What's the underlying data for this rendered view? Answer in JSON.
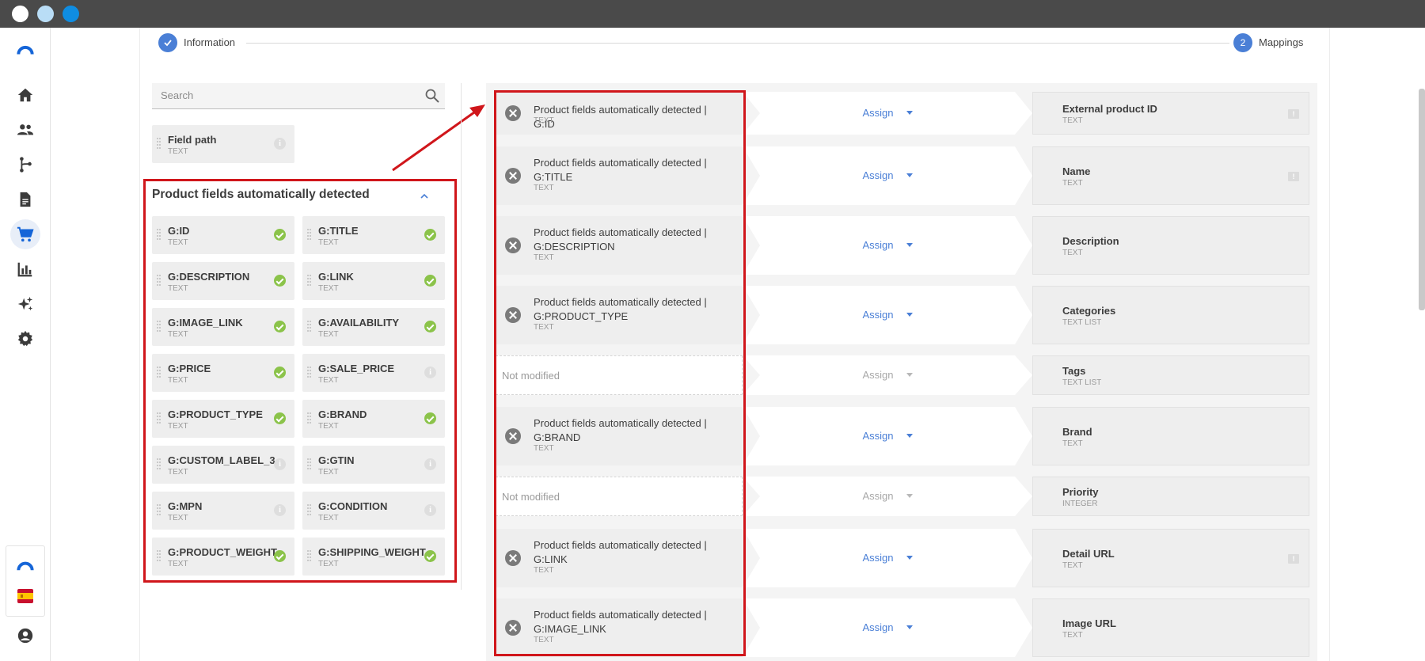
{
  "window": {
    "controls": [
      "close",
      "minimize",
      "maximize"
    ],
    "colors": {
      "close": "#ffffff",
      "minimize": "#b9ddf6",
      "maximize": "#0f8de2",
      "titlebar": "#4a4a4a"
    }
  },
  "nav": {
    "items": [
      "home-icon",
      "users-icon",
      "workflow-icon",
      "document-icon",
      "cart-icon",
      "chart-icon",
      "sparkles-icon",
      "gear-icon"
    ],
    "active": "cart-icon",
    "bottom": [
      "brand-logo-icon",
      "spain-flag-icon",
      "account-icon"
    ]
  },
  "stepper": {
    "steps": [
      {
        "label": "Information",
        "state": "done"
      },
      {
        "label": "Mappings",
        "number": "2",
        "state": "current"
      }
    ]
  },
  "search": {
    "placeholder": "Search"
  },
  "standalone_field": {
    "name": "Field path",
    "type": "TEXT",
    "status": "info"
  },
  "group": {
    "title": "Product fields automatically detected",
    "fields": [
      {
        "name": "G:ID",
        "type": "TEXT",
        "status": "ok"
      },
      {
        "name": "G:TITLE",
        "type": "TEXT",
        "status": "ok"
      },
      {
        "name": "G:DESCRIPTION",
        "type": "TEXT",
        "status": "ok"
      },
      {
        "name": "G:LINK",
        "type": "TEXT",
        "status": "ok"
      },
      {
        "name": "G:IMAGE_LINK",
        "type": "TEXT",
        "status": "ok"
      },
      {
        "name": "G:AVAILABILITY",
        "type": "TEXT",
        "status": "ok"
      },
      {
        "name": "G:PRICE",
        "type": "TEXT",
        "status": "ok"
      },
      {
        "name": "G:SALE_PRICE",
        "type": "TEXT",
        "status": "info"
      },
      {
        "name": "G:PRODUCT_TYPE",
        "type": "TEXT",
        "status": "ok"
      },
      {
        "name": "G:BRAND",
        "type": "TEXT",
        "status": "ok"
      },
      {
        "name": "G:CUSTOM_LABEL_3",
        "type": "TEXT",
        "status": "info"
      },
      {
        "name": "G:GTIN",
        "type": "TEXT",
        "status": "info"
      },
      {
        "name": "G:MPN",
        "type": "TEXT",
        "status": "info"
      },
      {
        "name": "G:CONDITION",
        "type": "TEXT",
        "status": "info"
      },
      {
        "name": "G:PRODUCT_WEIGHT",
        "type": "TEXT",
        "status": "ok"
      },
      {
        "name": "G:SHIPPING_WEIGHT",
        "type": "TEXT",
        "status": "ok"
      }
    ]
  },
  "mappings": {
    "assign_label": "Assign",
    "not_modified_label": "Not modified",
    "rows": [
      {
        "source": "Product fields automatically detected | G:ID",
        "source_type": "TEXT",
        "target": "External product ID",
        "target_type": "TEXT",
        "required": true
      },
      {
        "source": "Product fields automatically detected | G:TITLE",
        "source_type": "TEXT",
        "target": "Name",
        "target_type": "TEXT",
        "required": true
      },
      {
        "source": "Product fields automatically detected | G:DESCRIPTION",
        "source_type": "TEXT",
        "target": "Description",
        "target_type": "TEXT",
        "required": false
      },
      {
        "source": "Product fields automatically detected | G:PRODUCT_TYPE",
        "source_type": "TEXT",
        "target": "Categories",
        "target_type": "TEXT LIST",
        "required": false
      },
      {
        "source": null,
        "source_type": null,
        "target": "Tags",
        "target_type": "TEXT LIST",
        "required": false
      },
      {
        "source": "Product fields automatically detected | G:BRAND",
        "source_type": "TEXT",
        "target": "Brand",
        "target_type": "TEXT",
        "required": false
      },
      {
        "source": null,
        "source_type": null,
        "target": "Priority",
        "target_type": "INTEGER",
        "required": false
      },
      {
        "source": "Product fields automatically detected | G:LINK",
        "source_type": "TEXT",
        "target": "Detail URL",
        "target_type": "TEXT",
        "required": true
      },
      {
        "source": "Product fields automatically detected | G:IMAGE_LINK",
        "source_type": "TEXT",
        "target": "Image URL",
        "target_type": "TEXT",
        "required": false
      }
    ]
  },
  "colors": {
    "accent": "#4a7fd6",
    "ok": "#8bc34a",
    "highlight": "#d0161b"
  }
}
